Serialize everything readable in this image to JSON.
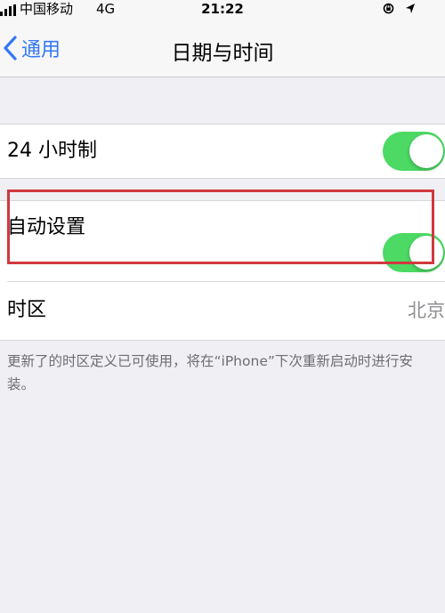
{
  "status_bar": {
    "carrier": "中国移动",
    "network": "4G",
    "time": "21:22"
  },
  "nav": {
    "back_label": "通用",
    "title": "日期与时间"
  },
  "settings": {
    "hour24": {
      "label": "24 小时制",
      "enabled": true
    },
    "auto_set": {
      "label": "自动设置",
      "enabled": true
    },
    "time_zone": {
      "label": "时区",
      "value": "北京"
    }
  },
  "footer_note": "更新了的时区定义已可使用，将在“iPhone”下次重新启动时进行安装。",
  "colors": {
    "toggle_on": "#4cd964",
    "link_blue": "#3478f6",
    "annotation_red": "#d0383d"
  }
}
